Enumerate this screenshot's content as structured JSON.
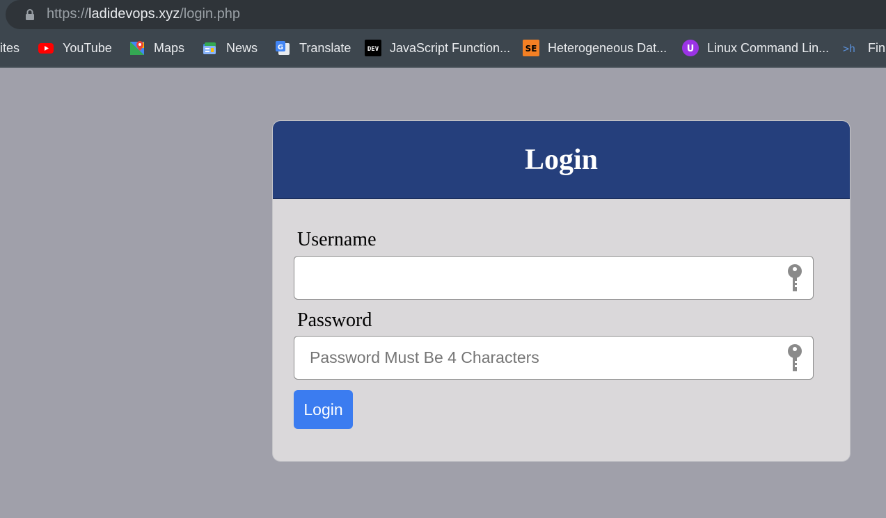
{
  "browser": {
    "url_scheme": "https://",
    "url_host": "ladidevops.xyz",
    "url_path": "/login.php",
    "bookmarks": [
      {
        "label": "ites",
        "icon": "apps-icon"
      },
      {
        "label": "YouTube",
        "icon": "youtube-icon"
      },
      {
        "label": "Maps",
        "icon": "maps-icon"
      },
      {
        "label": "News",
        "icon": "news-icon"
      },
      {
        "label": "Translate",
        "icon": "translate-icon"
      },
      {
        "label": "JavaScript Function...",
        "icon": "dev-icon"
      },
      {
        "label": "Heterogeneous Dat...",
        "icon": "se-icon"
      },
      {
        "label": "Linux Command Lin...",
        "icon": "u-icon"
      },
      {
        "label": "Fin",
        "icon": "terminal-icon"
      }
    ],
    "dev_icon_text": "DEV",
    "se_icon_text": "SE",
    "u_icon_text": "U",
    "terminal_icon_text": ">h"
  },
  "login": {
    "title": "Login",
    "username_label": "Username",
    "username_value": "",
    "password_label": "Password",
    "password_placeholder": "Password Must Be 4 Characters",
    "button_label": "Login"
  },
  "colors": {
    "page_bg": "#a0a0aa",
    "header_bg": "#253f7c",
    "card_bg": "#dad8da",
    "button_bg": "#3b7cf0"
  }
}
